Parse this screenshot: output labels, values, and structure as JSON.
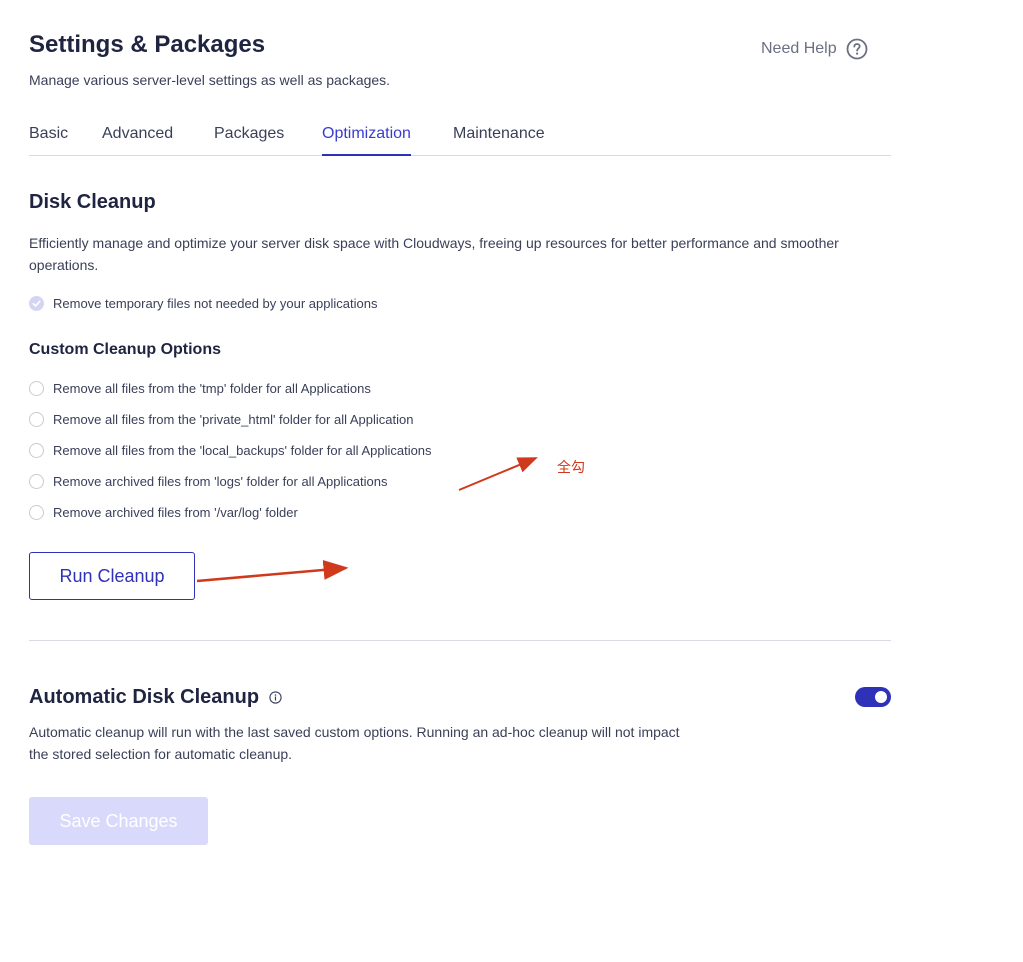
{
  "header": {
    "title": "Settings & Packages",
    "subtitle": "Manage various server-level settings as well as packages.",
    "help_label": "Need Help",
    "help_icon": "question-circle-icon"
  },
  "tabs": [
    {
      "label": "Basic",
      "active": false
    },
    {
      "label": "Advanced",
      "active": false
    },
    {
      "label": "Packages",
      "active": false
    },
    {
      "label": "Optimization",
      "active": true
    },
    {
      "label": "Maintenance",
      "active": false
    }
  ],
  "disk_cleanup": {
    "title": "Disk Cleanup",
    "description": "Efficiently manage and optimize your server disk space with Cloudways, freeing up resources for better performance and smoother operations.",
    "default_option": {
      "label": "Remove temporary files not needed by your applications",
      "checked": true,
      "disabled": true
    },
    "custom_title": "Custom Cleanup Options",
    "custom_options": [
      {
        "label": "Remove all files from the 'tmp' folder for all Applications",
        "checked": false
      },
      {
        "label": "Remove all files from the 'private_html' folder for all Application",
        "checked": false
      },
      {
        "label": "Remove all files from the 'local_backups' folder for all Applications",
        "checked": false
      },
      {
        "label": "Remove archived files from 'logs' folder for all Applications",
        "checked": false
      },
      {
        "label": "Remove archived files from '/var/log' folder",
        "checked": false
      }
    ],
    "run_button": "Run Cleanup"
  },
  "auto_cleanup": {
    "title": "Automatic Disk Cleanup",
    "info_icon": "info-circle-icon",
    "description_line1": "Automatic cleanup will run with the last saved custom options. Running an ad-hoc cleanup will not impact",
    "description_line2": "the stored selection for automatic cleanup.",
    "enabled": true,
    "save_button": "Save Changes"
  },
  "annotation": {
    "text": "全勾",
    "color": "#d0391b"
  },
  "colors": {
    "accent": "#2f31b8",
    "text": "#1f2440",
    "muted": "#3a3f58",
    "disabled_button": "#d9dafb"
  }
}
